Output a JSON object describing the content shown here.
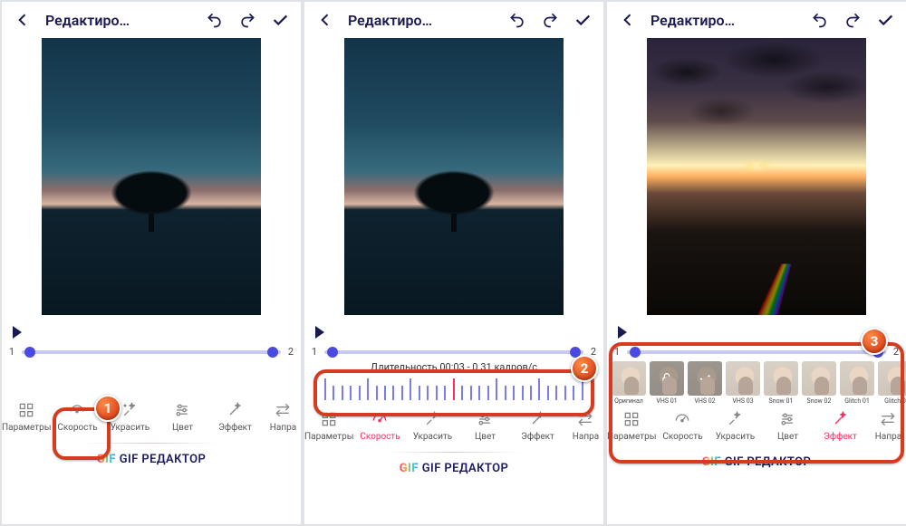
{
  "header": {
    "title": "Редактиро…"
  },
  "timeline": {
    "start": "1",
    "end": "2"
  },
  "tools": {
    "params": "Параметры",
    "speed": "Скорость",
    "decorate": "Украсить",
    "color": "Цвет",
    "effect": "Эффект",
    "dir": "Напра"
  },
  "speed_panel": {
    "label": "Длительность 00:03 - 0.31 кадров/с"
  },
  "fx": {
    "items": [
      "Оригинал",
      "VHS 01",
      "VHS 02",
      "VHS 03",
      "Snow 01",
      "Snow 02",
      "Glitch 01",
      "Glitch 0"
    ]
  },
  "brand": {
    "gif": "GIF",
    "text": "GIF РЕДАКТОР"
  },
  "badges": {
    "b1": "1",
    "b2": "2",
    "b3": "3"
  }
}
